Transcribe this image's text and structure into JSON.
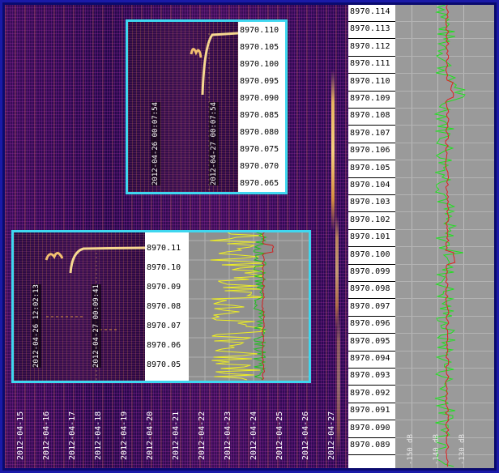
{
  "main_waterfall": {
    "date_labels": [
      "2012-04-15",
      "2012-04-16",
      "2012-04-17",
      "2012-04-18",
      "2012-04-19",
      "2012-04-20",
      "2012-04-21",
      "2012-04-22",
      "2012-04-23",
      "2012-04-24",
      "2012-04-25",
      "2012-04-26",
      "2012-04-27"
    ]
  },
  "frequency_scale": {
    "labels": [
      "8970.114",
      "8970.113",
      "8970.112",
      "8970.111",
      "8970.110",
      "8970.109",
      "8970.108",
      "8970.107",
      "8970.106",
      "8970.105",
      "8970.104",
      "8970.103",
      "8970.102",
      "8970.101",
      "8970.100",
      "8970.099",
      "8970.098",
      "8970.097",
      "8970.096",
      "8970.095",
      "8970.094",
      "8970.093",
      "8970.092",
      "8970.091",
      "8970.090",
      "8970.089"
    ]
  },
  "spectrum_panel": {
    "db_labels": [
      "-150 dB",
      "-140 dB",
      "-130 dB"
    ],
    "trace_colors": {
      "green": "#20e020",
      "red": "#e02020"
    }
  },
  "inset_top": {
    "date_labels": [
      "2012-04-26 00:07:54",
      "2012-04-27 00:07:54"
    ],
    "freq_labels": [
      "8970.110",
      "8970.105",
      "8970.100",
      "8970.095",
      "8970.090",
      "8970.085",
      "8970.080",
      "8970.075",
      "8970.070",
      "8970.065"
    ]
  },
  "inset_bottom": {
    "date_labels": [
      "2012-04-26 12:02:13",
      "2012-04-27 00:09:41"
    ],
    "freq_labels": [
      "8970.11",
      "8970.10",
      "8970.09",
      "8970.08",
      "8970.07",
      "8970.06",
      "8970.05"
    ],
    "trace_colors": {
      "yellow": "#f0f020",
      "green": "#20c020",
      "red": "#d02020"
    }
  },
  "colors": {
    "border": "#3fd7f0",
    "frame": "#1a1aa8"
  }
}
